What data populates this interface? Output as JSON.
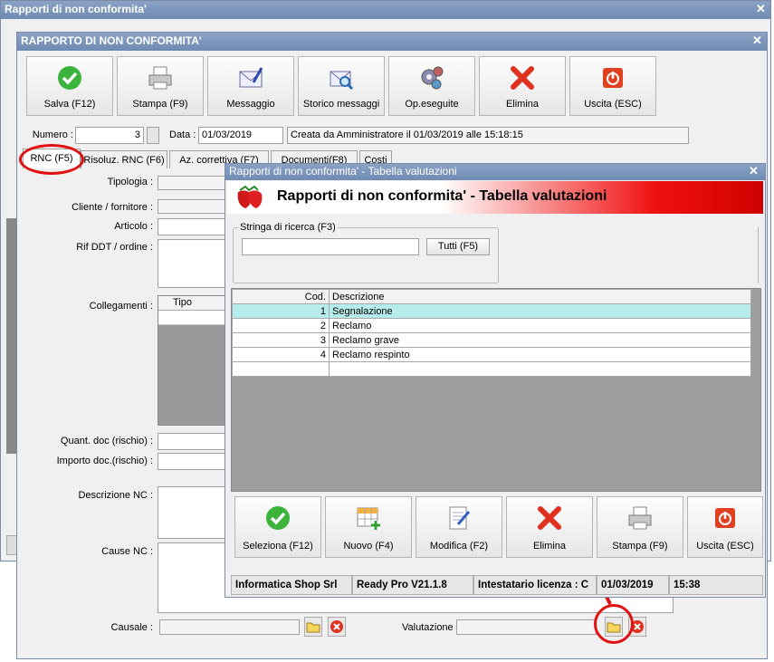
{
  "outer_window": {
    "title": "Rapporti di non conformita'"
  },
  "rnc_window": {
    "title": "RAPPORTO DI NON CONFORMITA'",
    "toolbar": [
      {
        "label": "Salva (F12)",
        "icon": "check-icon"
      },
      {
        "label": "Stampa (F9)",
        "icon": "printer-icon"
      },
      {
        "label": "Messaggio",
        "icon": "envelope-pen-icon"
      },
      {
        "label": "Storico messaggi",
        "icon": "envelope-search-icon"
      },
      {
        "label": "Op.eseguite",
        "icon": "gears-icon"
      },
      {
        "label": "Elimina",
        "icon": "red-x-icon"
      },
      {
        "label": "Uscita (ESC)",
        "icon": "power-icon"
      }
    ],
    "numero_label": "Numero :",
    "numero_value": "3",
    "data_label": "Data :",
    "data_value": "01/03/2019",
    "created_info": "Creata da Amministratore il 01/03/2019 alle 15:18:15",
    "tabs": [
      "RNC (F5)",
      "Risoluz. RNC (F6)",
      "Az. correttiva (F7)",
      "Documenti(F8)",
      "Costi"
    ],
    "labels": {
      "tipologia": "Tipologia :",
      "cliente": "Cliente / fornitore :",
      "articolo": "Articolo :",
      "rif_ddt": "Rif DDT / ordine :",
      "collegamenti": "Collegamenti :",
      "collegamenti_col": "Tipo",
      "quant_doc": "Quant. doc (rischio) :",
      "importo_doc": "Importo doc.(rischio) :",
      "descrizione_nc": "Descrizione NC :",
      "cause_nc": "Cause NC :",
      "causale": "Causale :",
      "valutazione": "Valutazione"
    }
  },
  "dialog": {
    "title": "Rapporti di non conformita' - Tabella valutazioni",
    "header": "Rapporti di non conformita' - Tabella valutazioni",
    "search_group": "Stringa di ricerca (F3)",
    "search_value": "",
    "tutti_button": "Tutti (F5)",
    "grid_headers": [
      "Cod.",
      "Descrizione"
    ],
    "rows": [
      {
        "cod": "1",
        "desc": "Segnalazione",
        "selected": true
      },
      {
        "cod": "2",
        "desc": "Reclamo",
        "selected": false
      },
      {
        "cod": "3",
        "desc": "Reclamo grave",
        "selected": false
      },
      {
        "cod": "4",
        "desc": "Reclamo respinto",
        "selected": false
      }
    ],
    "buttons": [
      {
        "label": "Seleziona (F12)",
        "icon": "check-icon"
      },
      {
        "label": "Nuovo (F4)",
        "icon": "grid-add-icon"
      },
      {
        "label": "Modifica (F2)",
        "icon": "edit-document-icon"
      },
      {
        "label": "Elimina",
        "icon": "red-x-icon"
      },
      {
        "label": "Stampa (F9)",
        "icon": "printer-icon"
      },
      {
        "label": "Uscita (ESC)",
        "icon": "power-icon"
      }
    ],
    "status": {
      "company": "Informatica Shop Srl",
      "version": "Ready Pro V21.1.8",
      "license": "Intestatario licenza : C",
      "date": "01/03/2019",
      "time": "15:38"
    }
  },
  "colors": {
    "accent_red": "#e01010",
    "title_blue": "#6f8bb3",
    "selected_row": "#b6ecec"
  }
}
